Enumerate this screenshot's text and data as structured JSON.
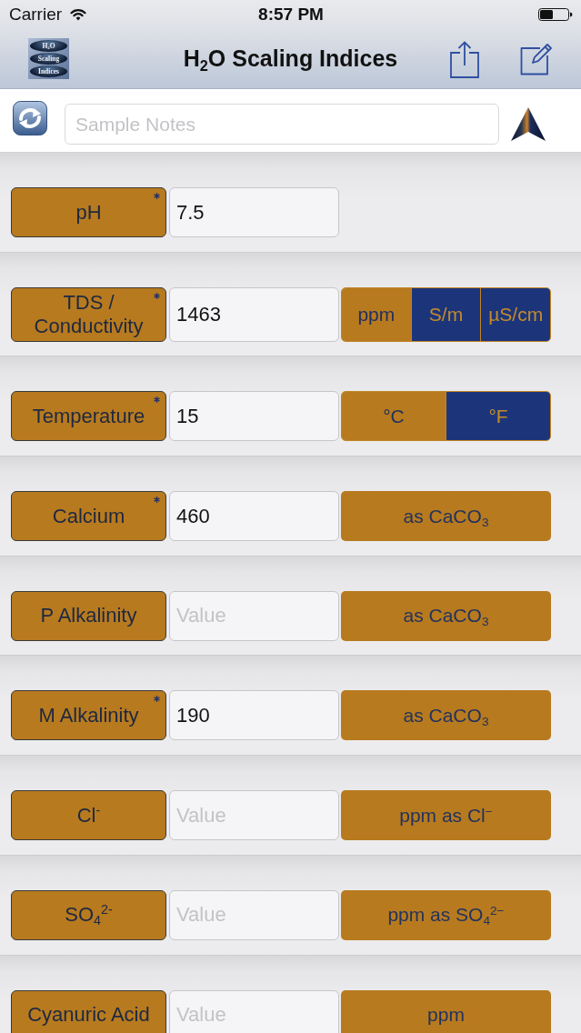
{
  "status_bar": {
    "carrier": "Carrier",
    "time": "8:57 PM"
  },
  "nav_bar": {
    "logo_lines": [
      "H$_{2}$O",
      "Scaling",
      "Indices"
    ],
    "title": "H$_{2}$O Scaling Indices"
  },
  "toolbar": {
    "notes": {
      "placeholder": "Sample Notes"
    }
  },
  "rows": [
    {
      "label": "pH",
      "required": true,
      "value": "7.5"
    },
    {
      "label": "TDS / Conductivity",
      "required": true,
      "value": "1463",
      "unit": {
        "kind": "segmented",
        "options": [
          {
            "label": "ppm",
            "selected": true
          },
          {
            "label": "S/m",
            "selected": false
          },
          {
            "label": "µS/cm",
            "selected": false
          }
        ]
      }
    },
    {
      "label": "Temperature",
      "required": true,
      "value": "15",
      "unit": {
        "kind": "segmented",
        "options": [
          {
            "label": "°C",
            "selected": true
          },
          {
            "label": "°F",
            "selected": false
          }
        ]
      }
    },
    {
      "label": "Calcium",
      "required": true,
      "value": "460",
      "unit": {
        "kind": "label",
        "text": "as CaCO$_{3}$"
      }
    },
    {
      "label": "P Alkalinity",
      "required": false,
      "placeholder": "Value",
      "unit": {
        "kind": "label",
        "text": "as CaCO$_{3}$"
      }
    },
    {
      "label": "M Alkalinity",
      "required": true,
      "value": "190",
      "unit": {
        "kind": "label",
        "text": "as CaCO$_{3}$"
      }
    },
    {
      "label": "Cl$^{-}$",
      "required": false,
      "placeholder": "Value",
      "unit": {
        "kind": "label",
        "text": "ppm as Cl$^{−}$"
      }
    },
    {
      "label": "SO$_{4}$$^{2-}$",
      "required": false,
      "placeholder": "Value",
      "unit": {
        "kind": "label",
        "text": "ppm as SO$_{4}$$^{2−}$"
      }
    },
    {
      "label": "Cyanuric Acid",
      "required": false,
      "placeholder": "Value",
      "unit": {
        "kind": "label",
        "text": "ppm"
      }
    }
  ]
}
